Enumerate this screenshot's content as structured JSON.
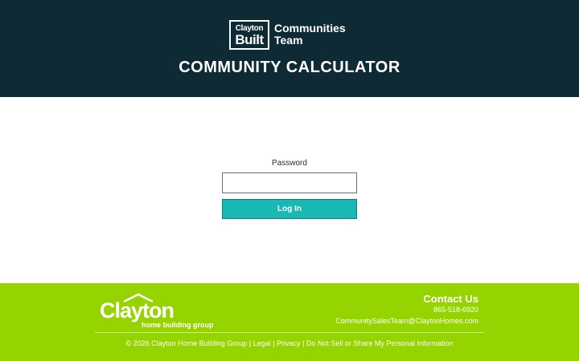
{
  "header": {
    "logo_top": "Clayton",
    "logo_bottom": "Built",
    "brand_line1": "Communities",
    "brand_line2": "Team",
    "title": "COMMUNITY CALCULATOR",
    "background": "#0d2a35"
  },
  "login": {
    "password_label": "Password",
    "password_value": "",
    "button_label": "Log In",
    "button_color": "#1ab8b3"
  },
  "footer": {
    "background": "#96d400",
    "logo_word": "Clayton",
    "logo_sub": "home building group",
    "contact_title": "Contact Us",
    "phone": "865-518-6920",
    "email": "CommunitySalesTeam@ClaytonHomes.com",
    "copyright": "© 2026 Clayton Home Building Group",
    "sep": "|",
    "links": [
      "Legal",
      "Privacy",
      "Do Not Sell or Share My Personal Information"
    ]
  }
}
